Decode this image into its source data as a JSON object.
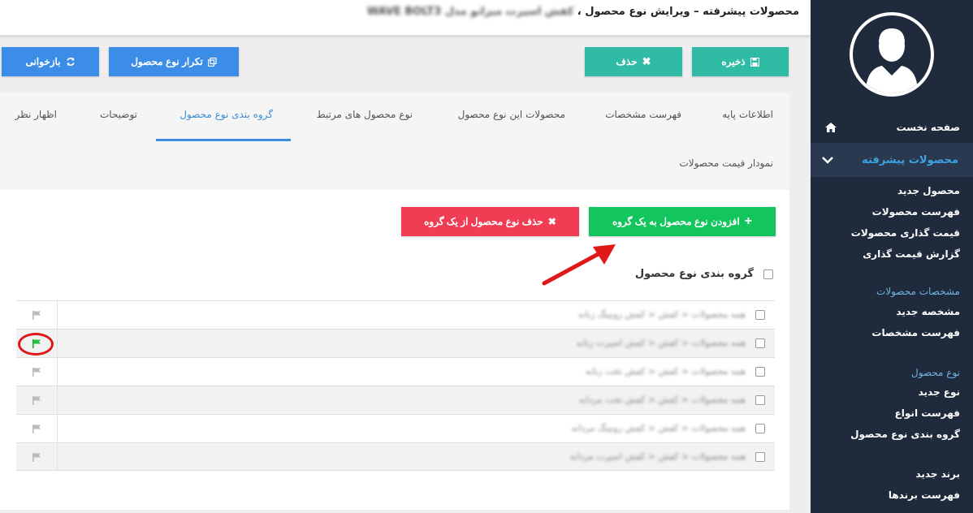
{
  "header": {
    "title_prefix": "محصولات پیشرفته – ویرایش نوع محصول ،",
    "title_blurred": "کفش اسپرت میزانو مدل WAVE BOLT3"
  },
  "toolbar": {
    "save_label": "ذخیره",
    "delete_label": "حذف",
    "duplicate_label": "تکرار نوع محصول",
    "reload_label": "بازخوانی"
  },
  "tabs": {
    "items": [
      {
        "label": "اطلاعات پایه"
      },
      {
        "label": "فهرست مشخصات"
      },
      {
        "label": "محصولات این نوع محصول"
      },
      {
        "label": "نوع محصول های مرتبط"
      },
      {
        "label": "گروه بندی نوع محصول"
      },
      {
        "label": "توضیحات"
      },
      {
        "label": "اظهار نظر"
      }
    ],
    "second_row": "نمودار قیمت محصولات"
  },
  "actions": {
    "add_label": "افزودن نوع محصول به یک گروه",
    "remove_label": "حذف نوع محصول از یک گروه"
  },
  "group_table": {
    "header": "گروه بندی نوع محصول",
    "rows": [
      {
        "text": "همه محصولات < کفش < کفش رونینگ زنانه",
        "flag": "gray"
      },
      {
        "text": "همه محصولات < کفش < کفش اسپرت زنانه",
        "flag": "green"
      },
      {
        "text": "همه محصولات < کفش < کفش تخت زنانه",
        "flag": "gray"
      },
      {
        "text": "همه محصولات < کفش < کفش تخت مردانه",
        "flag": "gray"
      },
      {
        "text": "همه محصولات < کفش < کفش رونینگ مردانه",
        "flag": "gray"
      },
      {
        "text": "همه محصولات < کفش < کفش اسپرت مردانه",
        "flag": "gray"
      }
    ]
  },
  "sidebar": {
    "home": "صفحه نخست",
    "active_section": "محصولات پیشرفته",
    "items": [
      {
        "label": "محصول جدید"
      },
      {
        "label": "فهرست محصولات"
      },
      {
        "label": "قیمت گذاری محصولات"
      },
      {
        "label": "گزارش قیمت گذاری"
      }
    ],
    "spec_header": "مشخصات محصولات",
    "spec_items": [
      {
        "label": "مشخصه جدید"
      },
      {
        "label": "فهرست مشخصات"
      }
    ],
    "type_header": "نوع محصول",
    "type_items": [
      {
        "label": "نوع جدید"
      },
      {
        "label": "فهرست انواع"
      },
      {
        "label": "گروه بندی نوع محصول"
      }
    ],
    "brand_items": [
      {
        "label": "برند جدید"
      },
      {
        "label": "فهرست برندها"
      }
    ]
  },
  "colors": {
    "accent": "#3a8fd8",
    "teal": "#2fbba4",
    "blue": "#3b8de8",
    "green": "#12c55c",
    "red": "#f03d54",
    "sidebar_bg": "#1f2a3c"
  }
}
